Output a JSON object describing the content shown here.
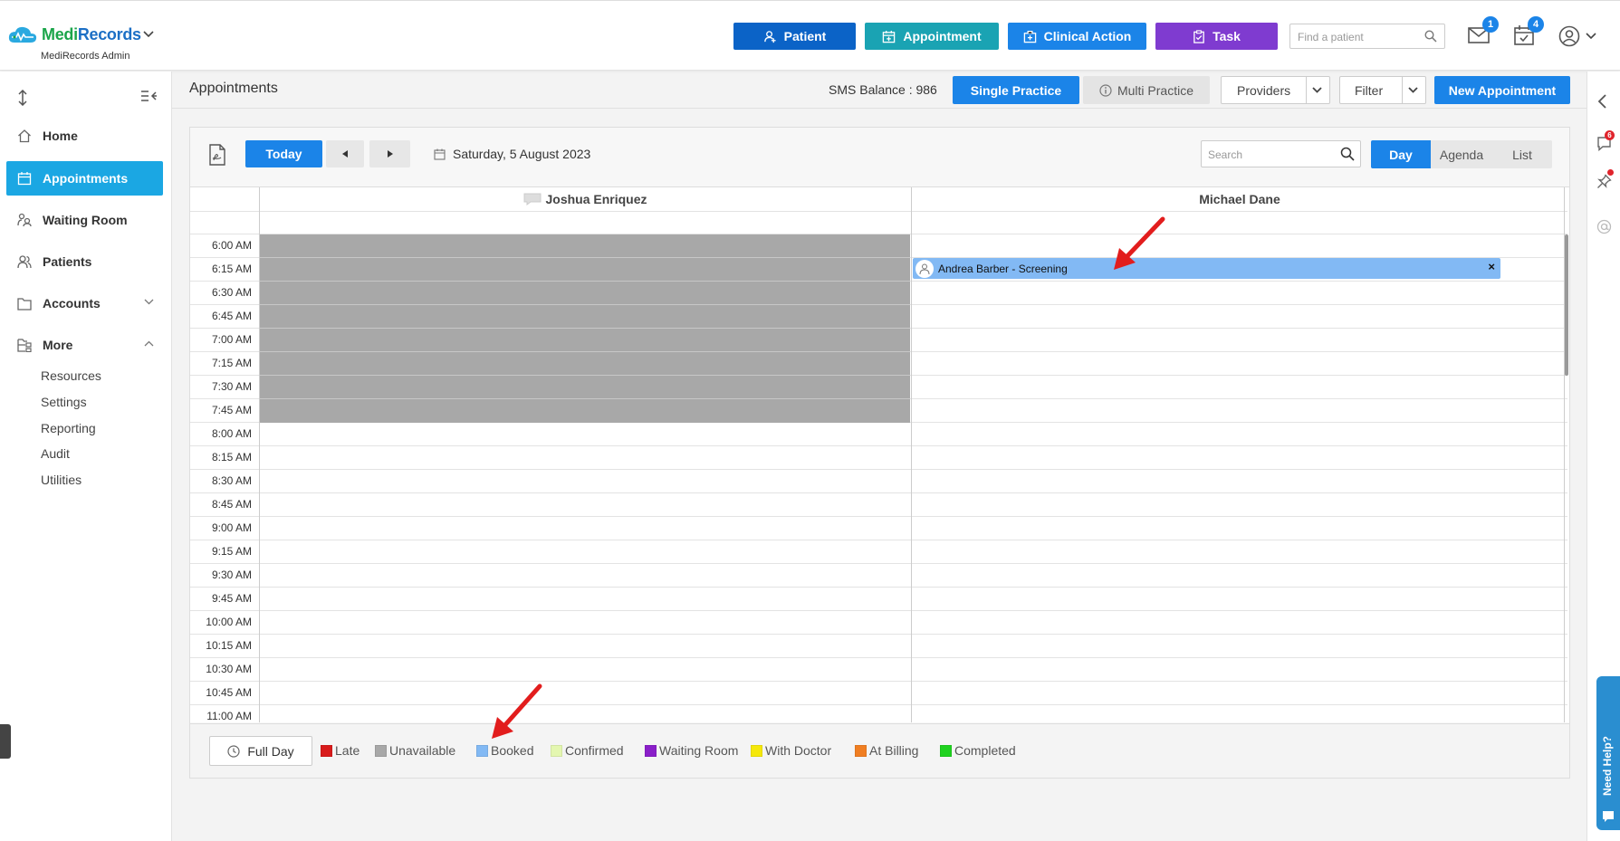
{
  "app": {
    "logo_text_1": "Medi",
    "logo_text_2": "Records",
    "subtitle": "MediRecords Admin"
  },
  "topbar": {
    "buttons": [
      {
        "label": "Patient",
        "icon": "add-user-icon",
        "color": "#0b63c7"
      },
      {
        "label": "Appointment",
        "icon": "calendar-icon",
        "color": "#1aa3b3"
      },
      {
        "label": "Clinical Action",
        "icon": "medical-kit-icon",
        "color": "#1b84e8"
      },
      {
        "label": "Task",
        "icon": "clipboard-icon",
        "color": "#7f3bd0"
      }
    ],
    "find_patient_placeholder": "Find a patient",
    "mail_badge": "1",
    "tasks_badge": "4"
  },
  "sidebar": {
    "items": [
      {
        "label": "Home",
        "icon": "home-icon"
      },
      {
        "label": "Appointments",
        "icon": "calendar-icon",
        "active": true
      },
      {
        "label": "Waiting Room",
        "icon": "waiting-room-icon"
      },
      {
        "label": "Patients",
        "icon": "users-icon"
      },
      {
        "label": "Accounts",
        "icon": "folder-icon",
        "expandable": true
      },
      {
        "label": "More",
        "icon": "folder-tree-icon",
        "expanded": true
      }
    ],
    "sub_items": [
      "Resources",
      "Settings",
      "Reporting",
      "Audit",
      "Utilities"
    ]
  },
  "header": {
    "title": "Appointments",
    "sms_balance": "SMS Balance : 986",
    "single_practice": "Single Practice",
    "multi_practice": "Multi Practice",
    "providers": "Providers",
    "filter": "Filter",
    "new_appointment": "New Appointment"
  },
  "calendar": {
    "today": "Today",
    "date": "Saturday, 5 August 2023",
    "search_placeholder": "Search",
    "views": [
      "Day",
      "Agenda",
      "List"
    ],
    "active_view": "Day",
    "providers": [
      "Joshua Enriquez",
      "Michael Dane"
    ],
    "times": [
      "6:00 AM",
      "6:15 AM",
      "6:30 AM",
      "6:45 AM",
      "7:00 AM",
      "7:15 AM",
      "7:30 AM",
      "7:45 AM",
      "8:00 AM",
      "8:15 AM",
      "8:30 AM",
      "8:45 AM",
      "9:00 AM",
      "9:15 AM",
      "9:30 AM",
      "9:45 AM",
      "10:00 AM",
      "10:15 AM",
      "10:30 AM",
      "10:45 AM",
      "11:00 AM"
    ],
    "appointment": {
      "label": "Andrea Barber - Screening",
      "provider": "Michael Dane",
      "time": "6:15 AM",
      "status": "Booked"
    }
  },
  "legend": {
    "full_day": "Full Day",
    "items": [
      {
        "label": "Late",
        "color": "#d81b1b"
      },
      {
        "label": "Unavailable",
        "color": "#a8a8a8"
      },
      {
        "label": "Booked",
        "color": "#82b9f4"
      },
      {
        "label": "Confirmed",
        "color": "#e4f7b0"
      },
      {
        "label": "Waiting Room",
        "color": "#8a1fc9"
      },
      {
        "label": "With Doctor",
        "color": "#f5e80a"
      },
      {
        "label": "At Billing",
        "color": "#f07e22"
      },
      {
        "label": "Completed",
        "color": "#1fd21f"
      }
    ]
  },
  "right_rail": {
    "chat_badge": "6"
  },
  "need_help": "Need Help?"
}
